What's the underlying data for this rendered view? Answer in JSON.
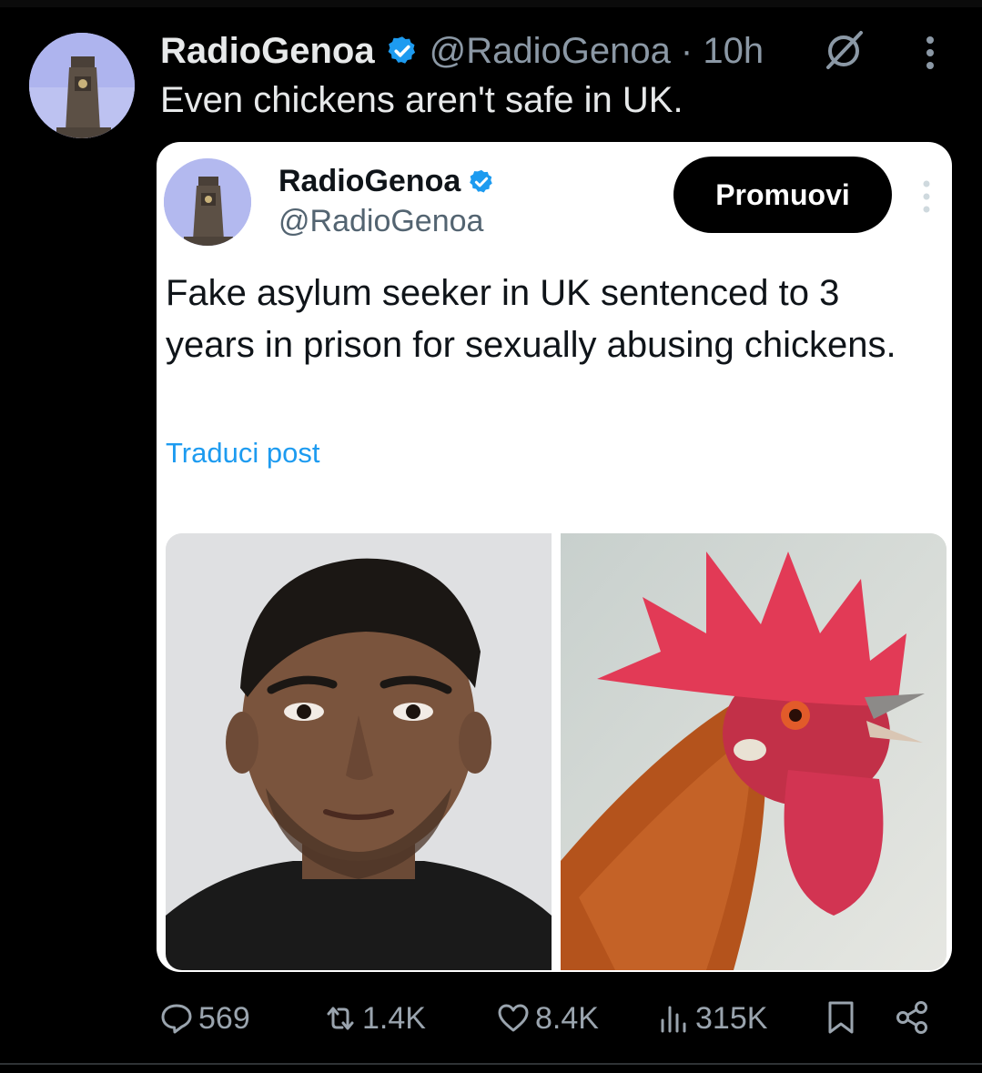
{
  "post": {
    "author": {
      "display_name": "RadioGenoa",
      "handle_time": "@RadioGenoa · 10h"
    },
    "text": "Even chickens aren't safe in UK.",
    "icons": {
      "verified": "verified-badge-icon",
      "grok": "grok-icon",
      "more": "more-icon"
    }
  },
  "quoted": {
    "display_name": "RadioGenoa",
    "handle": "@RadioGenoa",
    "promote_label": "Promuovi",
    "text": "Fake asylum seeker in UK sentenced to 3 years in prison for sexually abusing chickens.",
    "translate_label": "Traduci post",
    "media": [
      "mugshot-photo",
      "rooster-photo"
    ]
  },
  "actions": {
    "replies": "569",
    "reposts": "1.4K",
    "likes": "8.4K",
    "views": "315K"
  },
  "colors": {
    "background": "#000000",
    "text": "#e7e9ea",
    "secondary_text": "#8b98a5",
    "verified": "#1d9bf0",
    "link": "#1d9bf0",
    "card": "#ffffff"
  }
}
